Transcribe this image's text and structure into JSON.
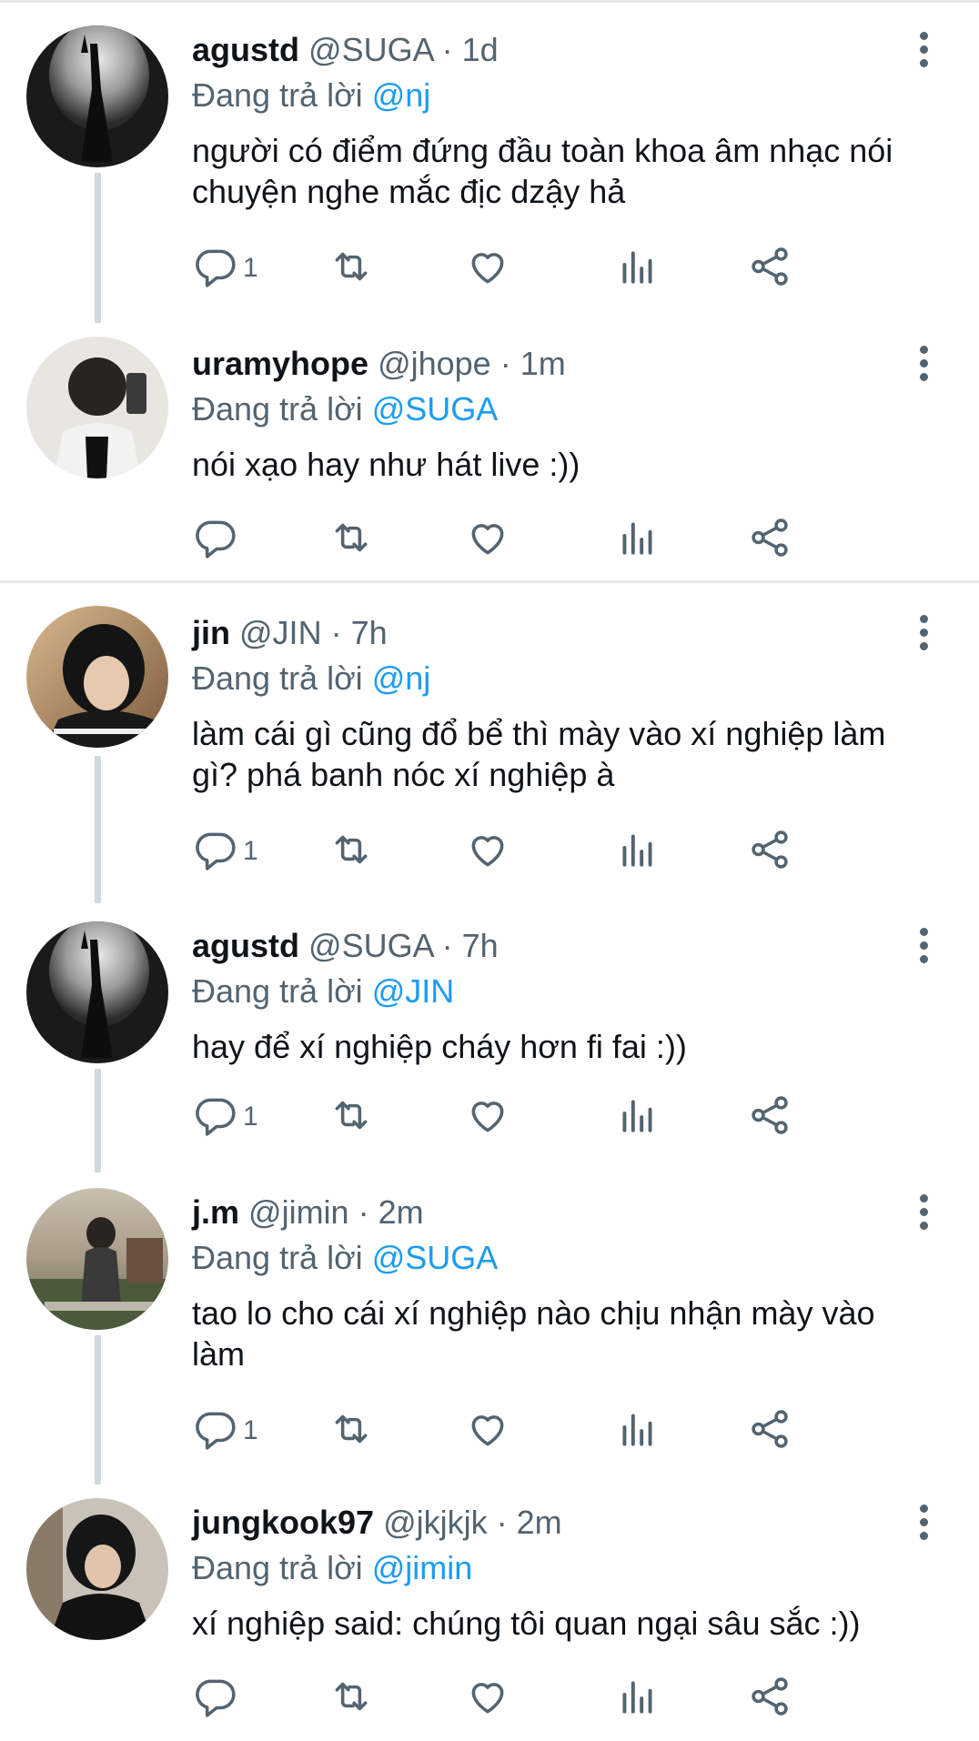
{
  "reply_prefix": "Đang trả lời",
  "colors": {
    "accent": "#1d9bf0",
    "muted": "#536471",
    "text": "#0f1419",
    "thread_line": "#cfd9de"
  },
  "tweets": [
    {
      "name": "agustd",
      "handle": "@SUGA",
      "sep": "·",
      "time": "1d",
      "reply_to": "@nj",
      "lines": [
        "người có điểm đứng đầu toàn khoa âm nhạc nói",
        "chuyện nghe mắc địc dzậy hả"
      ],
      "reply_count": "1",
      "avatar": "dark-silhouette-smoke"
    },
    {
      "name": "uramyhope",
      "handle": "@jhope",
      "sep": "·",
      "time": "1m",
      "reply_to": "@SUGA",
      "lines": [
        "nói xạo hay như hát live :))"
      ],
      "reply_count": "",
      "avatar": "mirror-selfie-light"
    },
    {
      "name": "jin",
      "handle": "@JIN",
      "sep": "·",
      "time": "7h",
      "reply_to": "@nj",
      "lines": [
        "làm cái gì cũng đổ bể thì mày vào xí nghiệp làm",
        "gì? phá banh nóc xí nghiệp à"
      ],
      "reply_count": "1",
      "avatar": "dark-hair-portrait"
    },
    {
      "name": "agustd",
      "handle": "@SUGA",
      "sep": "·",
      "time": "7h",
      "reply_to": "@JIN",
      "lines": [
        "hay để xí nghiệp cháy hơn fi fai :))"
      ],
      "reply_count": "1",
      "avatar": "dark-silhouette-smoke"
    },
    {
      "name": "j.m",
      "handle": "@jimin",
      "sep": "·",
      "time": "2m",
      "reply_to": "@SUGA",
      "lines": [
        "tao lo cho cái xí nghiệp nào chịu nhận mày vào",
        "làm"
      ],
      "reply_count": "1",
      "avatar": "outdoor-sunset"
    },
    {
      "name": "jungkook97",
      "handle": "@jkjkjk",
      "sep": "·",
      "time": "2m",
      "reply_to": "@jimin",
      "lines": [
        "xí nghiệp said: chúng tôi quan ngại sâu sắc :))"
      ],
      "reply_count": "",
      "avatar": "dark-jacket-portrait"
    }
  ],
  "icons": [
    "reply-icon",
    "retweet-icon",
    "like-icon",
    "views-icon",
    "share-icon",
    "more-icon"
  ]
}
